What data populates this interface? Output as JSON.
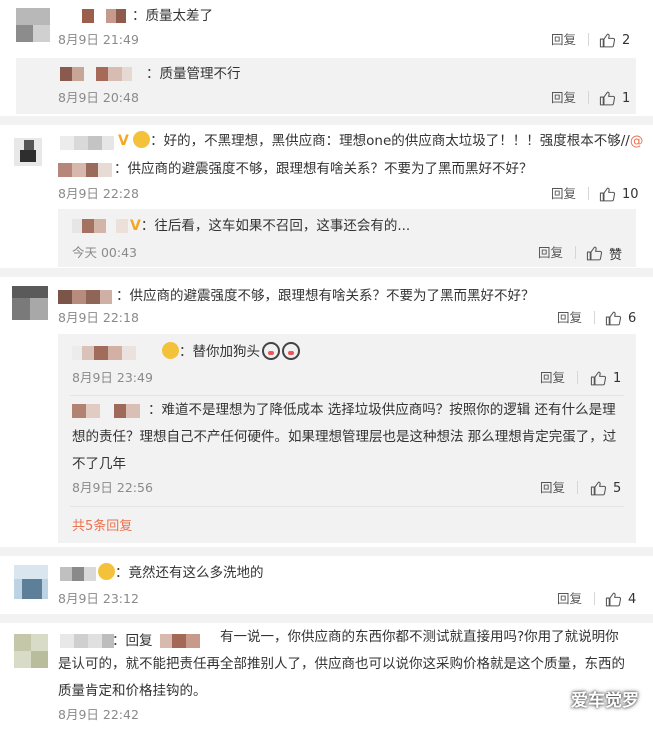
{
  "comments": [
    {
      "text": "：质量太差了",
      "time": "8月9日 21:49",
      "reply": "回复",
      "likes": "2"
    },
    {
      "text": "：质量管理不行",
      "time": "8月9日 20:48",
      "reply": "回复",
      "likes": "1"
    },
    {
      "text_line1": "：好的，不黑理想，黑供应商：理想one的供应商太垃圾了！！！强度根本不够//",
      "mention_at": "@",
      "text_line2": "：供应商的避震强度不够，跟理想有啥关系？不要为了黑而黑好不好？",
      "time": "8月9日 22:28",
      "reply": "回复",
      "likes": "10",
      "sub_reply": {
        "text": "：往后看，这车如果不召回，这事还会有的...",
        "time": "今天 00:43",
        "reply": "回复",
        "likes": "赞"
      }
    },
    {
      "text": "：供应商的避震强度不够，跟理想有啥关系？不要为了黑而黑好不好？",
      "time": "8月9日 22:18",
      "reply": "回复",
      "likes": "6",
      "sub_replies": [
        {
          "text": "：替你加狗头",
          "time": "8月9日 23:49",
          "reply": "回复",
          "likes": "1"
        },
        {
          "text": "：难道不是理想为了降低成本 选择垃圾供应商吗？按照你的逻辑 还有什么是理想的责任？理想自己不产任何硬件。如果理想管理层也是这种想法 那么理想肯定完蛋了，过不了几年",
          "time": "8月9日 22:56",
          "reply": "回复",
          "likes": "5"
        }
      ],
      "more_replies": "共5条回复"
    },
    {
      "text": "：竟然还有这么多洗地的",
      "time": "8月9日 23:12",
      "reply": "回复",
      "likes": "4"
    },
    {
      "reply_prefix": "：回复",
      "text": "有一说一，你供应商的东西你都不测试就直接用吗?你用了就说明你是认可的，就不能把责任再全部推别人了，供应商也可以说你这采购价格就是这个质量，东西的质量肯定和价格挂钩的。",
      "time": "8月9日 22:42"
    }
  ],
  "watermark": {
    "text": "爱车觉罗"
  },
  "icons": {
    "like": "thumbs-up-icon",
    "vip": "v-badge-icon",
    "emoji": "emoji-icon",
    "dog": "dog-head-icon",
    "watermark": "wechat-icon"
  },
  "colors": {
    "accent": "#eb7350",
    "vip": "#f5a623",
    "background_alt": "#f2f2f2",
    "muted": "#8a8a8a"
  }
}
